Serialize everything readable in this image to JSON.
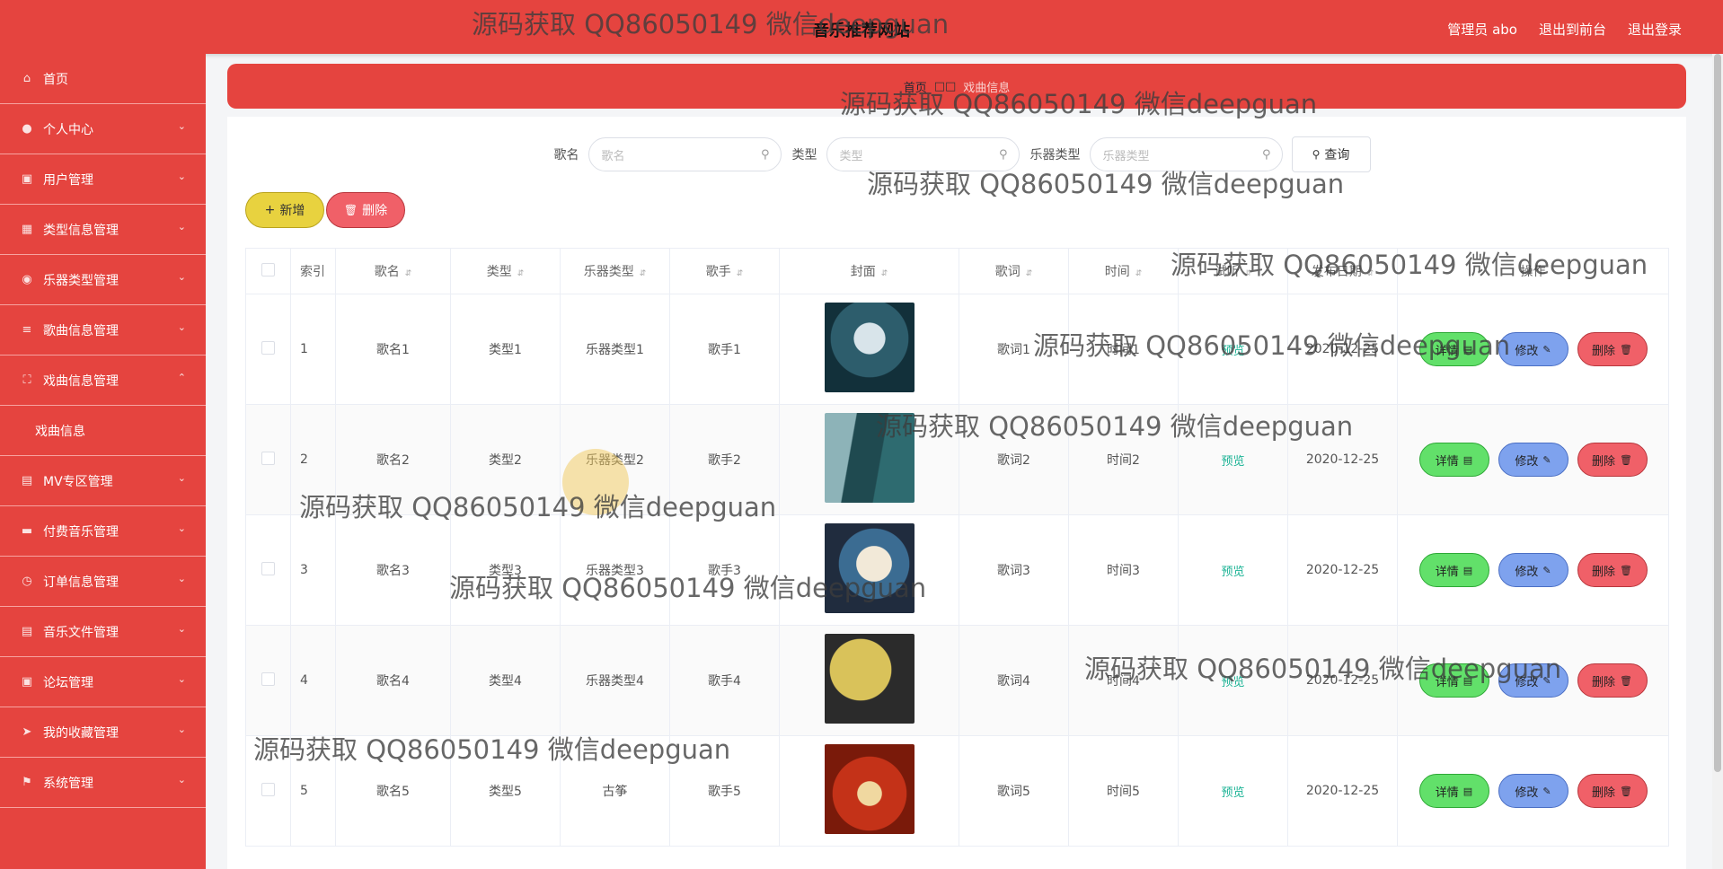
{
  "header": {
    "title": "音乐推荐网站",
    "admin": "管理员 abo",
    "to_front": "退出到前台",
    "logout": "退出登录"
  },
  "sidebar": {
    "items": [
      {
        "label": "首页",
        "icon": "home-icon",
        "has_sub": false
      },
      {
        "label": "个人中心",
        "icon": "user-icon",
        "has_sub": true
      },
      {
        "label": "用户管理",
        "icon": "users-icon",
        "has_sub": true
      },
      {
        "label": "类型信息管理",
        "icon": "chart-icon",
        "has_sub": true
      },
      {
        "label": "乐器类型管理",
        "icon": "location-icon",
        "has_sub": true
      },
      {
        "label": "歌曲信息管理",
        "icon": "sliders-icon",
        "has_sub": true
      },
      {
        "label": "戏曲信息管理",
        "icon": "expand-icon",
        "has_sub": true,
        "expanded": true
      },
      {
        "label": "MV专区管理",
        "icon": "bar-chart-icon",
        "has_sub": true
      },
      {
        "label": "付费音乐管理",
        "icon": "monitor-icon",
        "has_sub": true
      },
      {
        "label": "订单信息管理",
        "icon": "clock-icon",
        "has_sub": true
      },
      {
        "label": "音乐文件管理",
        "icon": "files-icon",
        "has_sub": true
      },
      {
        "label": "论坛管理",
        "icon": "briefcase-icon",
        "has_sub": true
      },
      {
        "label": "我的收藏管理",
        "icon": "send-icon",
        "has_sub": true
      },
      {
        "label": "系统管理",
        "icon": "flag-icon",
        "has_sub": true
      }
    ],
    "sub_label": "戏曲信息"
  },
  "breadcrumb": {
    "home": "首页",
    "sep": "□□",
    "current": "戏曲信息"
  },
  "search": {
    "name_label": "歌名",
    "name_placeholder": "歌名",
    "type_label": "类型",
    "type_placeholder": "类型",
    "instrument_label": "乐器类型",
    "instrument_placeholder": "乐器类型",
    "query_label": "查询"
  },
  "actions": {
    "add": "新增",
    "delete": "删除"
  },
  "table": {
    "headers": [
      "索引",
      "歌名",
      "类型",
      "乐器类型",
      "歌手",
      "封面",
      "歌词",
      "时间",
      "试听",
      "发布日期",
      "操作"
    ],
    "rows": [
      {
        "idx": "1",
        "name": "歌名1",
        "type": "类型1",
        "instrument": "乐器类型1",
        "singer": "歌手1",
        "lyrics": "歌词1",
        "time": "时间1",
        "preview": "预览",
        "date": "2020-12-25"
      },
      {
        "idx": "2",
        "name": "歌名2",
        "type": "类型2",
        "instrument": "乐器类型2",
        "singer": "歌手2",
        "lyrics": "歌词2",
        "time": "时间2",
        "preview": "预览",
        "date": "2020-12-25"
      },
      {
        "idx": "3",
        "name": "歌名3",
        "type": "类型3",
        "instrument": "乐器类型3",
        "singer": "歌手3",
        "lyrics": "歌词3",
        "time": "时间3",
        "preview": "预览",
        "date": "2020-12-25"
      },
      {
        "idx": "4",
        "name": "歌名4",
        "type": "类型4",
        "instrument": "乐器类型4",
        "singer": "歌手4",
        "lyrics": "歌词4",
        "time": "时间4",
        "preview": "预览",
        "date": "2020-12-25"
      },
      {
        "idx": "5",
        "name": "歌名5",
        "type": "类型5",
        "instrument": "古筝",
        "singer": "歌手5",
        "lyrics": "歌词5",
        "time": "时间5",
        "preview": "预览",
        "date": "2020-12-25"
      }
    ],
    "row_actions": {
      "detail": "详情",
      "edit": "修改",
      "remove": "删除"
    }
  },
  "watermark": "源码获取 QQ86050149 微信deepguan",
  "colors": {
    "brand": "#e5443f",
    "add": "#e8d23f",
    "danger": "#f06068",
    "detail": "#62e06a",
    "edit": "#7ea2ee",
    "preview": "#1bb395"
  }
}
